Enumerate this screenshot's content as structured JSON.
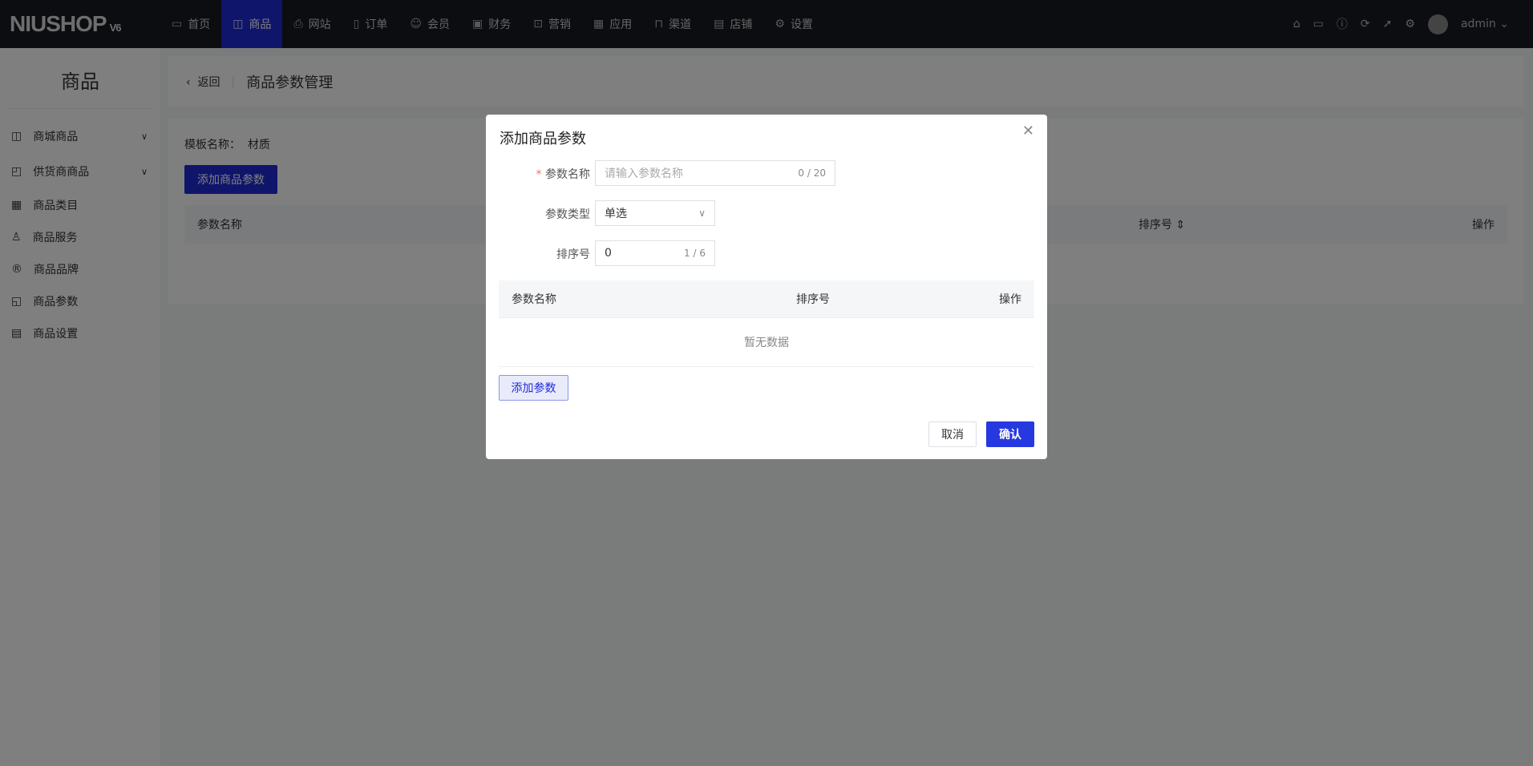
{
  "header": {
    "logo": "NIUSHOP",
    "version": "V6",
    "nav": [
      {
        "label": "首页",
        "icon": "monitor-icon"
      },
      {
        "label": "商品",
        "icon": "bag-icon"
      },
      {
        "label": "网站",
        "icon": "printer-icon"
      },
      {
        "label": "订单",
        "icon": "clipboard-icon"
      },
      {
        "label": "会员",
        "icon": "user-icon"
      },
      {
        "label": "财务",
        "icon": "wallet-icon"
      },
      {
        "label": "营销",
        "icon": "chart-icon"
      },
      {
        "label": "应用",
        "icon": "grid-icon"
      },
      {
        "label": "渠道",
        "icon": "channel-icon"
      },
      {
        "label": "店铺",
        "icon": "shop-icon"
      },
      {
        "label": "设置",
        "icon": "gear-icon"
      }
    ],
    "user": "admin"
  },
  "sidebar": {
    "title": "商品",
    "items": [
      {
        "label": "商城商品"
      },
      {
        "label": "供货商商品"
      },
      {
        "label": "商品类目"
      },
      {
        "label": "商品服务"
      },
      {
        "label": "商品品牌"
      },
      {
        "label": "商品参数"
      },
      {
        "label": "商品设置"
      }
    ]
  },
  "page": {
    "back": "返回",
    "title": "商品参数管理",
    "template_label": "模板名称：",
    "template_value": "材质",
    "add_button": "添加商品参数",
    "columns": [
      "参数名称",
      "排序号",
      "操作"
    ]
  },
  "dialog": {
    "title": "添加商品参数",
    "name_label": "参数名称",
    "name_placeholder": "请输入参数名称",
    "name_count": "0 / 20",
    "type_label": "参数类型",
    "type_value": "单选",
    "sort_label": "排序号",
    "sort_value": "0",
    "sort_count": "1 / 6",
    "columns": [
      "参数名称",
      "排序号",
      "操作"
    ],
    "empty": "暂无数据",
    "add_param": "添加参数",
    "cancel": "取消",
    "confirm": "确认"
  },
  "colors": {
    "primary": "#1f2bd6",
    "header": "#181b22"
  }
}
